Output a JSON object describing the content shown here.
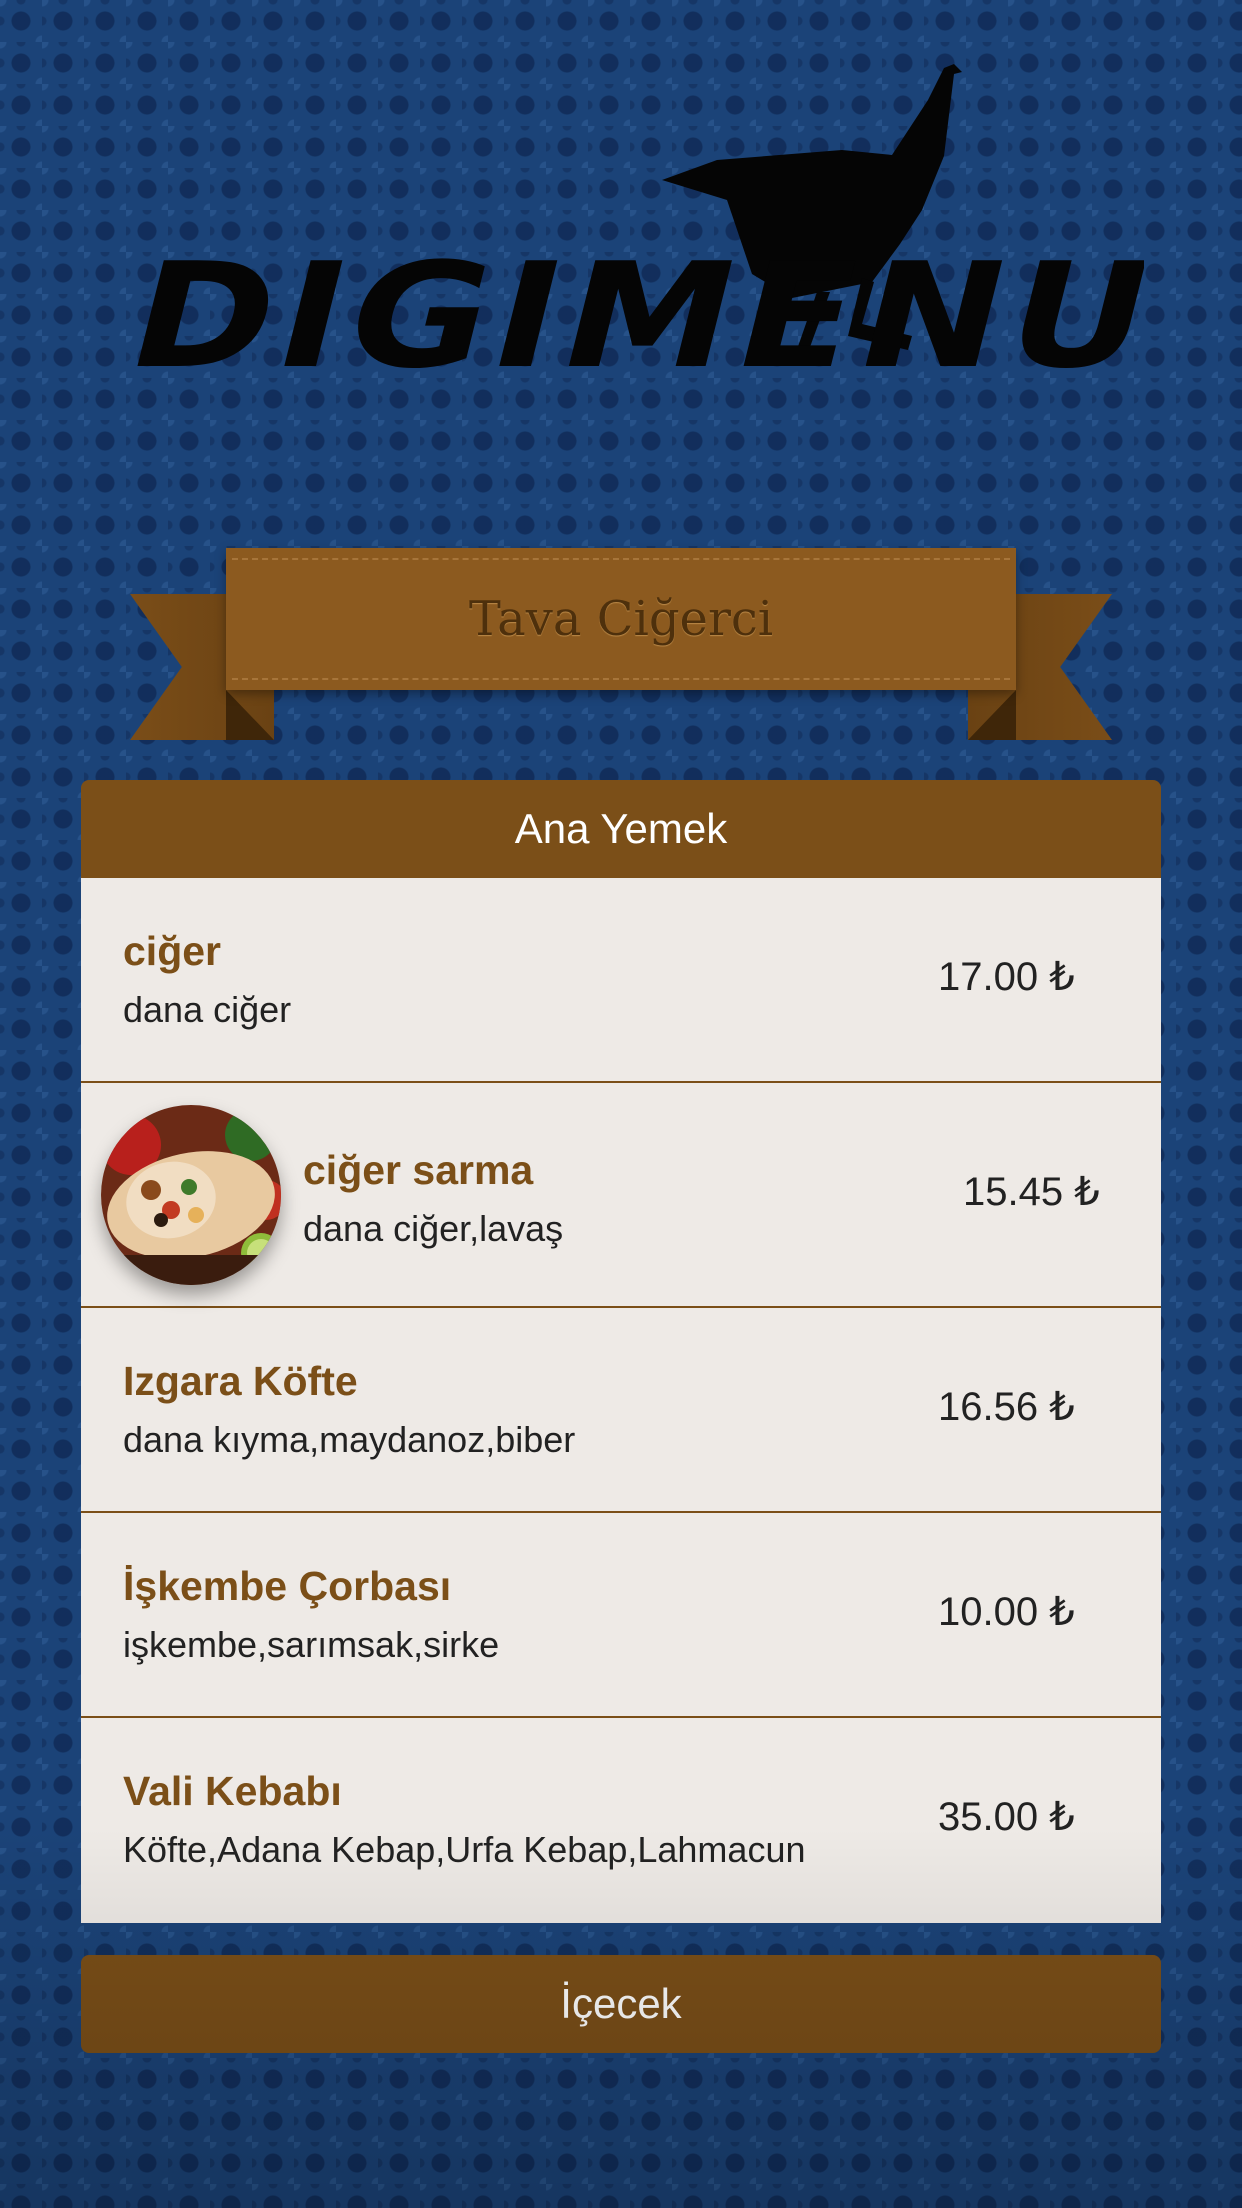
{
  "restaurant": {
    "name": "Tava Ciğerci"
  },
  "logo": {
    "text": "DIGIMENU"
  },
  "categories": [
    {
      "label": "Ana Yemek",
      "items": [
        {
          "name": "ciğer",
          "description": "dana ciğer",
          "price": "17.00 ₺"
        },
        {
          "name": "ciğer sarma",
          "description": "dana ciğer,lavaş",
          "price": "15.45 ₺",
          "image": "wrap-photo"
        },
        {
          "name": "Izgara Köfte",
          "description": "dana kıyma,maydanoz,biber",
          "price": "16.56 ₺"
        },
        {
          "name": "İşkembe Çorbası",
          "description": "işkembe,sarımsak,sirke",
          "price": "10.00 ₺"
        },
        {
          "name": "Vali Kebabı",
          "description": "Köfte,Adana Kebap,Urfa Kebap,Lahmacun",
          "price": "35.00 ₺"
        }
      ]
    },
    {
      "label": "İçecek",
      "items": []
    }
  ],
  "colors": {
    "background": "#1b4378",
    "accent": "#7b4f18",
    "banner": "#8c5a1f",
    "card": "#eeeae6"
  }
}
